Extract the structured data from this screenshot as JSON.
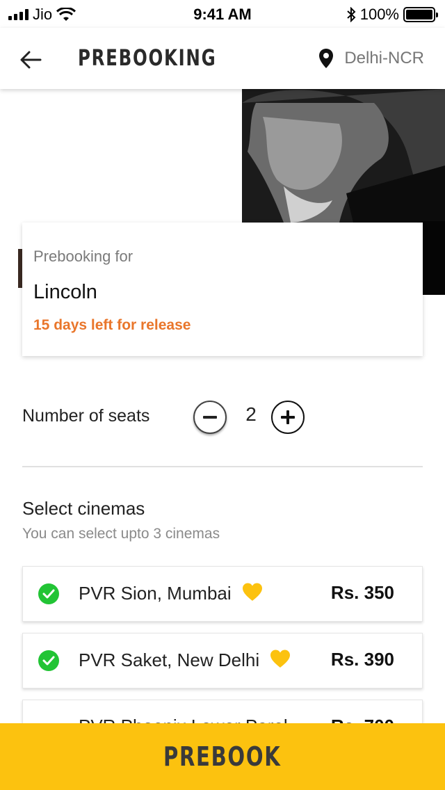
{
  "status_bar": {
    "carrier": "Jio",
    "time": "9:41 AM",
    "battery": "100%"
  },
  "header": {
    "title": "PREBOOKING",
    "location": "Delhi-NCR"
  },
  "movie_card": {
    "label": "Prebooking for",
    "title": "Lincoln",
    "release_note": "15 days left for release"
  },
  "seats": {
    "label": "Number of seats",
    "count": "2"
  },
  "cinemas": {
    "title": "Select cinemas",
    "subtitle": "You can select upto 3 cinemas",
    "items": [
      {
        "name": "PVR Sion, Mumbai",
        "price": "Rs. 350",
        "selected": true,
        "favorite": true
      },
      {
        "name": "PVR Saket, New Delhi",
        "price": "Rs. 390",
        "selected": true,
        "favorite": true
      },
      {
        "name": "PVR Phoenix Lower Parel",
        "price": "Rs. 700",
        "selected": false,
        "favorite": false
      }
    ]
  },
  "bottom_bar": {
    "button_label": "PREBOOK"
  },
  "colors": {
    "accent": "#fcc20f",
    "release_note": "#e9762b",
    "check": "#22c435",
    "heart": "#fcc20f"
  }
}
